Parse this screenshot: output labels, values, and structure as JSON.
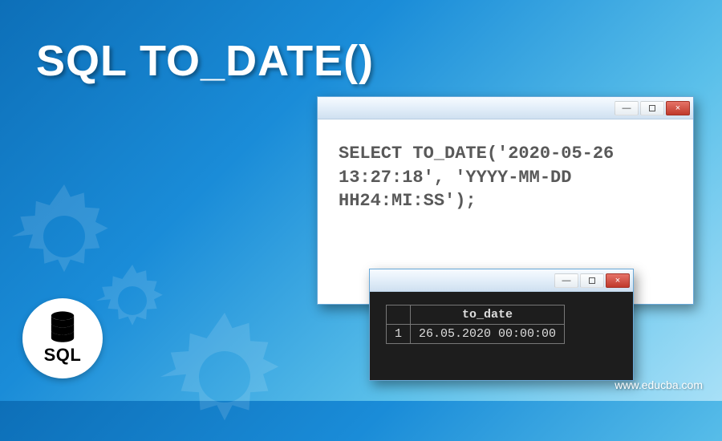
{
  "page": {
    "title": "SQL TO_DATE()",
    "footer_url": "www.educba.com"
  },
  "badge": {
    "label": "SQL"
  },
  "editor": {
    "code": "SELECT TO_DATE('2020-05-26 13:27:18', 'YYYY-MM-DD HH24:MI:SS');"
  },
  "result": {
    "header": "to_date",
    "row_index": "1",
    "value": "26.05.2020 00:00:00"
  },
  "window_controls": {
    "minimize": "—",
    "close": "×"
  }
}
